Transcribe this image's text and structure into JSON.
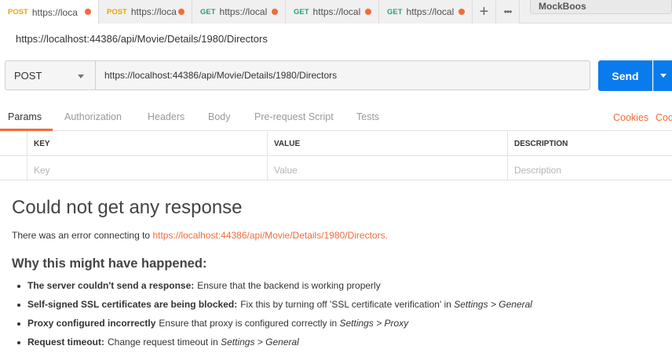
{
  "tabs": [
    {
      "method": "POST",
      "url": "https://loca",
      "active": true
    },
    {
      "method": "POST",
      "url": "https://loca",
      "active": false
    },
    {
      "method": "GET",
      "url": "https://local",
      "active": false
    },
    {
      "method": "GET",
      "url": "https://local",
      "active": false
    },
    {
      "method": "GET",
      "url": "https://local",
      "active": false
    }
  ],
  "tab_actions": {
    "add_glyph": "+",
    "more_glyph": "•••"
  },
  "environment": {
    "label": "MockBoos"
  },
  "request": {
    "name": "https://localhost:44386/api/Movie/Details/1980/Directors",
    "method": "POST",
    "url": "https://localhost:44386/api/Movie/Details/1980/Directors",
    "send_label": "Send"
  },
  "request_tabs": [
    "Params",
    "Authorization",
    "Headers",
    "Body",
    "Pre-request Script",
    "Tests"
  ],
  "request_links": {
    "cookies": "Cookies",
    "code": "Cod"
  },
  "params": {
    "headers": [
      "KEY",
      "VALUE",
      "DESCRIPTION"
    ],
    "placeholders": {
      "key": "Key",
      "value": "Value",
      "description": "Description"
    }
  },
  "response": {
    "title": "Could not get any response",
    "error_prefix": "There was an error connecting to ",
    "error_url": "https://localhost:44386/api/Movie/Details/1980/Directors.",
    "why_heading": "Why this might have happened:",
    "reasons": [
      {
        "bold": "The server couldn't send a response:",
        "text": "Ensure that the backend is working properly",
        "italic": ""
      },
      {
        "bold": "Self-signed SSL certificates are being blocked:",
        "text": "Fix this by turning off 'SSL certificate verification' in ",
        "italic": "Settings > General"
      },
      {
        "bold": "Proxy configured incorrectly",
        "text": "Ensure that proxy is configured correctly in ",
        "italic": "Settings > Proxy"
      },
      {
        "bold": "Request timeout:",
        "text": "Change request timeout in ",
        "italic": "Settings > General"
      }
    ]
  },
  "colors": {
    "accent": "#f26b3a",
    "send_blue": "#097bed",
    "post": "#e8a408",
    "get": "#24a472"
  }
}
